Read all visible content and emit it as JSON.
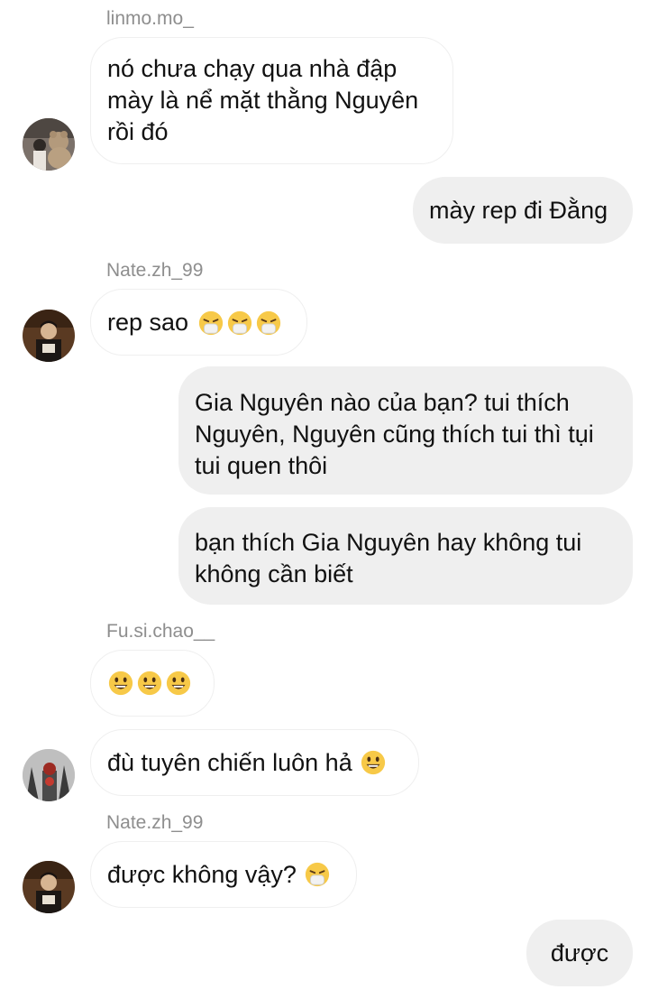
{
  "colors": {
    "incoming_bg": "#ffffff",
    "incoming_border": "#efefef",
    "outgoing_bg": "#efefef",
    "sender_name": "#8e8e8e",
    "text": "#111111"
  },
  "messages": [
    {
      "sender": "linmo.mo_",
      "text": "nó chưa chạy qua nhà đập mày là nể mặt thằng Nguyên rồi đó",
      "direction": "incoming"
    },
    {
      "text": "mày rep đi Đằng",
      "direction": "outgoing"
    },
    {
      "sender": "Nate.zh_99",
      "text": "rep sao",
      "emojis": [
        "sneezing-face",
        "sneezing-face",
        "sneezing-face"
      ],
      "direction": "incoming"
    },
    {
      "text": "Gia Nguyên nào của bạn? tui thích Nguyên, Nguyên cũng thích tui thì tụi tui quen thôi",
      "direction": "outgoing"
    },
    {
      "text": "bạn thích Gia Nguyên hay không tui không cần biết",
      "direction": "outgoing"
    },
    {
      "sender": "Fu.si.chao__",
      "emojis": [
        "grinning-face",
        "grinning-face",
        "grinning-face"
      ],
      "direction": "incoming"
    },
    {
      "text": "đù tuyên chiến luôn hả",
      "emojis": [
        "grinning-face"
      ],
      "direction": "incoming"
    },
    {
      "sender": "Nate.zh_99",
      "text": "được không vậy?",
      "emojis": [
        "sneezing-face"
      ],
      "direction": "incoming"
    },
    {
      "text": "được",
      "direction": "outgoing"
    }
  ]
}
